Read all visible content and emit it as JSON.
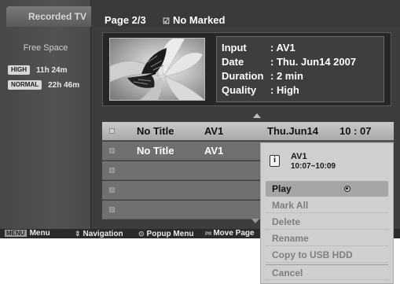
{
  "sidebar": {
    "tab_label": "Recorded TV",
    "free_space_label": "Free Space",
    "quality_rows": [
      {
        "badge": "HIGH",
        "time": "11h 24m"
      },
      {
        "badge": "NORMAL",
        "time": "22h 46m"
      }
    ]
  },
  "header": {
    "page_label": "Page 2/3",
    "marked_icon": "☑",
    "marked_label": "No Marked"
  },
  "info_panel": {
    "lines": [
      {
        "key": "Input",
        "value": ": AV1"
      },
      {
        "key": "Date",
        "value": ": Thu. Jun14 2007"
      },
      {
        "key": "Duration",
        "value": ": 2 min"
      },
      {
        "key": "Quality",
        "value": ": High"
      }
    ]
  },
  "recordings": [
    {
      "title": "No Title",
      "source": "AV1",
      "date": "Thu.Jun14",
      "time": "10 : 07",
      "selected": true
    },
    {
      "title": "No Title",
      "source": "AV1",
      "date": "",
      "time": "",
      "selected": false
    },
    {
      "title": "",
      "source": "",
      "date": "",
      "time": "",
      "selected": false
    },
    {
      "title": "",
      "source": "",
      "date": "",
      "time": "",
      "selected": false
    },
    {
      "title": "",
      "source": "",
      "date": "",
      "time": "",
      "selected": false
    }
  ],
  "footer": {
    "menu_key": "MENU",
    "menu_label": "Menu",
    "nav_glyph": "⇕",
    "nav_label": "Navigation",
    "popup_glyph": "⊙",
    "popup_label": "Popup Menu",
    "pr_glyph": "PR",
    "move_label": "Move Page"
  },
  "popup": {
    "source": "AV1",
    "time_range": "10:07~10:09",
    "items": [
      "Play",
      "Mark All",
      "Delete",
      "Rename",
      "Copy to USB HDD",
      "Cancel"
    ],
    "active_item": "Play"
  }
}
